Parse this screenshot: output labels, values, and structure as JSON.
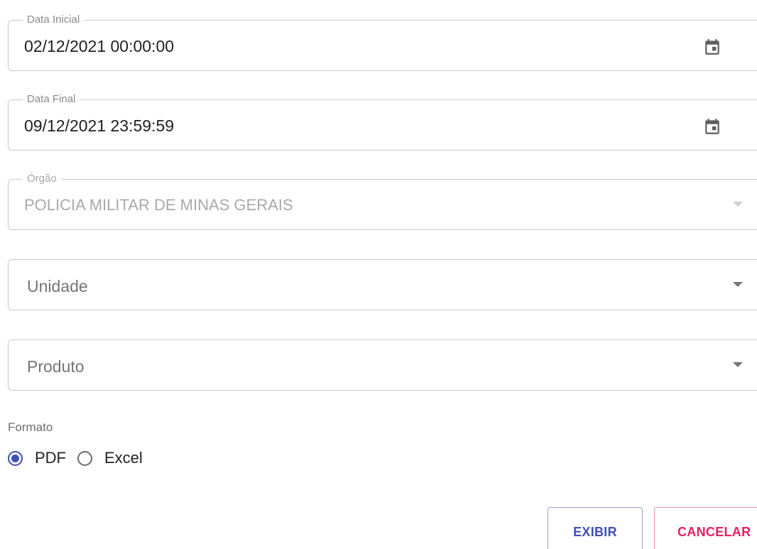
{
  "form": {
    "data_inicial": {
      "label": "Data Inicial",
      "value": "02/12/2021 00:00:00",
      "icon": "calendar-icon"
    },
    "data_final": {
      "label": "Data Final",
      "value": "09/12/2021 23:59:59",
      "icon": "calendar-icon"
    },
    "orgao": {
      "label": "Órgão",
      "value": "POLICIA MILITAR DE MINAS GERAIS",
      "disabled": true
    },
    "unidade": {
      "placeholder": "Unidade"
    },
    "produto": {
      "placeholder": "Produto"
    },
    "formato": {
      "label": "Formato",
      "options": [
        {
          "label": "PDF",
          "checked": true
        },
        {
          "label": "Excel",
          "checked": false
        }
      ]
    }
  },
  "actions": {
    "exibir_label": "EXIBIR",
    "cancelar_label": "CANCELAR"
  },
  "colors": {
    "primary": "#3f51b5",
    "accent": "#e91e63"
  }
}
